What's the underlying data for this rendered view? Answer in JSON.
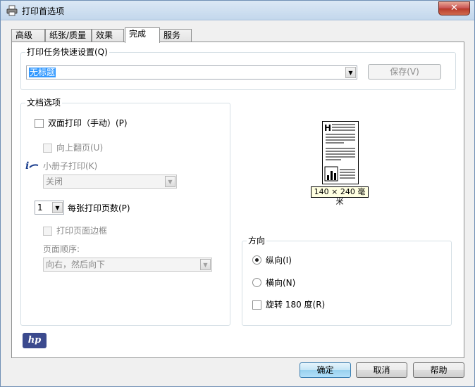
{
  "window": {
    "title": "打印首选项",
    "close_label": "✕"
  },
  "tabs": [
    {
      "label": "高级"
    },
    {
      "label": "纸张/质量"
    },
    {
      "label": "效果"
    },
    {
      "label": "完成",
      "active": true
    },
    {
      "label": "服务"
    }
  ],
  "quick_settings": {
    "group_label": "打印任务快速设置(Q)",
    "selected": "无标题",
    "save_label": "保存(V)"
  },
  "document_options": {
    "group_label": "文档选项",
    "duplex_label": "双面打印（手动）(P)",
    "flip_up_label": "向上翻页(U)",
    "booklet_label": "小册子打印(K)",
    "booklet_value": "关闭",
    "pages_per_sheet_value": "1",
    "pages_per_sheet_label": "每张打印页数(P)",
    "page_borders_label": "打印页面边框",
    "page_order_label": "页面顺序:",
    "page_order_value": "向右，然后向下"
  },
  "preview": {
    "size_label": "140 × 240 毫米"
  },
  "orientation": {
    "group_label": "方向",
    "portrait_label": "纵向(I)",
    "landscape_label": "横向(N)",
    "rotate_label": "旋转 180 度(R)",
    "selected": "portrait"
  },
  "brand": {
    "logo_text": "hp"
  },
  "footer": {
    "ok_label": "确定",
    "cancel_label": "取消",
    "help_label": "帮助"
  },
  "colors": {
    "accent": "#3399ff",
    "hp_blue": "#3b4a8e"
  }
}
